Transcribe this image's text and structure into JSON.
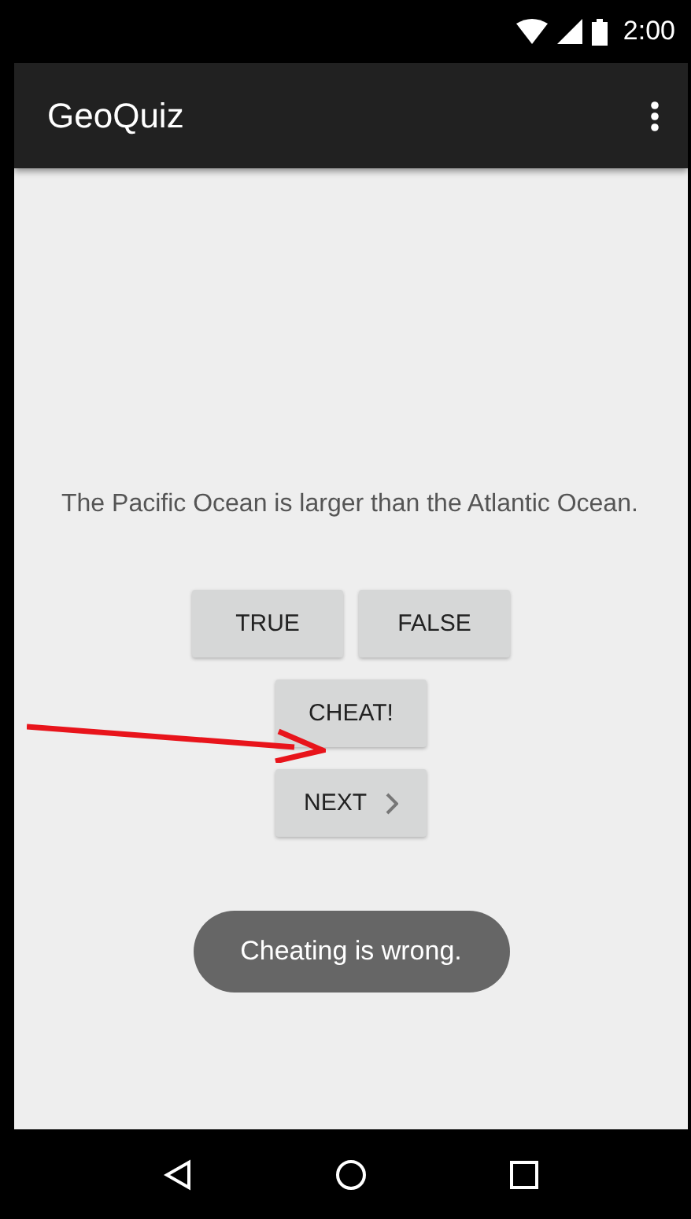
{
  "status_bar": {
    "time": "2:00"
  },
  "app_bar": {
    "title": "GeoQuiz"
  },
  "question": "The Pacific Ocean is larger than the Atlantic Ocean.",
  "answer_buttons": [
    {
      "label": "TRUE"
    },
    {
      "label": "FALSE"
    }
  ],
  "cheat_button": {
    "label": "CHEAT!"
  },
  "next_button": {
    "label": "NEXT"
  },
  "toast": {
    "text": "Cheating is wrong."
  }
}
